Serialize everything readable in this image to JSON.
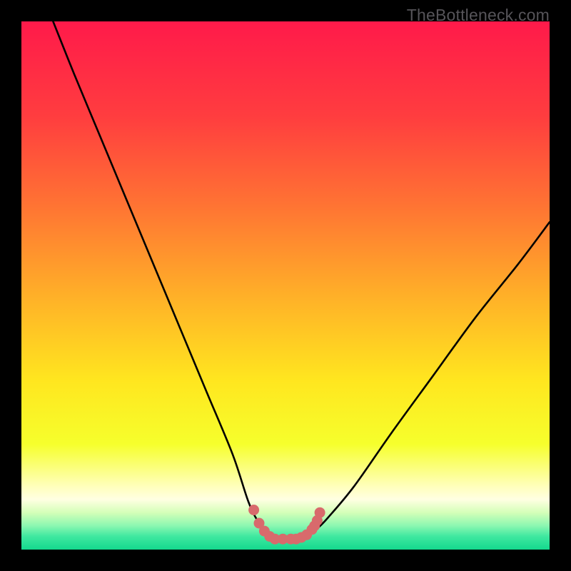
{
  "watermark": "TheBottleneck.com",
  "colors": {
    "black": "#000000",
    "curve": "#000000",
    "marker": "#d86a6c",
    "gradient_stops": [
      {
        "pos": 0.0,
        "color": "#ff1a4a"
      },
      {
        "pos": 0.18,
        "color": "#ff3d3f"
      },
      {
        "pos": 0.35,
        "color": "#ff7433"
      },
      {
        "pos": 0.52,
        "color": "#ffb028"
      },
      {
        "pos": 0.68,
        "color": "#ffe61f"
      },
      {
        "pos": 0.8,
        "color": "#f6ff2c"
      },
      {
        "pos": 0.88,
        "color": "#ffffbb"
      },
      {
        "pos": 0.905,
        "color": "#ffffe2"
      },
      {
        "pos": 0.93,
        "color": "#d4ffb8"
      },
      {
        "pos": 0.955,
        "color": "#8bf7b1"
      },
      {
        "pos": 0.975,
        "color": "#3fe8a0"
      },
      {
        "pos": 1.0,
        "color": "#14d98e"
      }
    ]
  },
  "chart_data": {
    "type": "line",
    "title": "",
    "xlabel": "",
    "ylabel": "",
    "xlim": [
      0,
      100
    ],
    "ylim": [
      0,
      100
    ],
    "series": [
      {
        "name": "bottleneck-curve",
        "x": [
          6,
          10,
          15,
          20,
          25,
          30,
          35,
          40,
          43,
          45,
          47,
          49.5,
          52,
          54,
          56,
          58,
          63,
          70,
          78,
          86,
          94,
          100
        ],
        "y": [
          100,
          90,
          78,
          66,
          54,
          42,
          30,
          18,
          9,
          5,
          2.5,
          2,
          2,
          2.5,
          4,
          6,
          12,
          22,
          33,
          44,
          54,
          62
        ]
      }
    ],
    "markers": {
      "name": "basin-markers",
      "x": [
        44,
        45,
        46,
        47,
        48,
        49.5,
        51,
        52,
        53,
        54,
        55,
        55.5,
        56,
        56.5
      ],
      "y": [
        7.5,
        5,
        3.5,
        2.5,
        2,
        2,
        2,
        2,
        2.3,
        2.8,
        3.8,
        4.5,
        5.5,
        7
      ]
    }
  }
}
